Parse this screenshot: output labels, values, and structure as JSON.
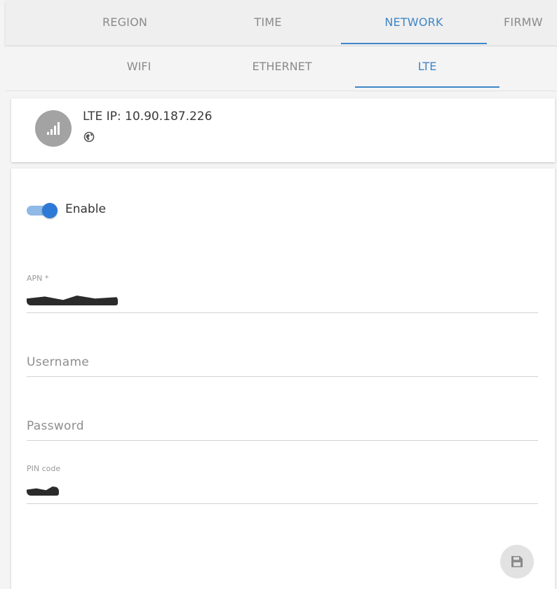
{
  "top_tabs": [
    {
      "label": "REGION",
      "active": false
    },
    {
      "label": "TIME",
      "active": false
    },
    {
      "label": "NETWORK",
      "active": true
    },
    {
      "label": "FIRMW",
      "active": false
    }
  ],
  "sub_tabs": [
    {
      "label": "WIFI",
      "active": false
    },
    {
      "label": "ETHERNET",
      "active": false
    },
    {
      "label": "LTE",
      "active": true
    }
  ],
  "status": {
    "ip_text": "LTE IP: 10.90.187.226",
    "signal_icon": "signal-bars-icon",
    "globe_icon": "globe-icon"
  },
  "form": {
    "enable": {
      "label": "Enable",
      "checked": true
    },
    "apn": {
      "label": "APN *",
      "value": "[redacted]"
    },
    "username": {
      "placeholder": "Username"
    },
    "password": {
      "placeholder": "Password"
    },
    "pin": {
      "label": "PIN code",
      "value": "[redacted]"
    },
    "save_icon": "floppy-disk-icon"
  },
  "colors": {
    "accent": "#3f86c8",
    "toggle_on": "#2d7ad6",
    "avatar": "#a3a3a3"
  }
}
